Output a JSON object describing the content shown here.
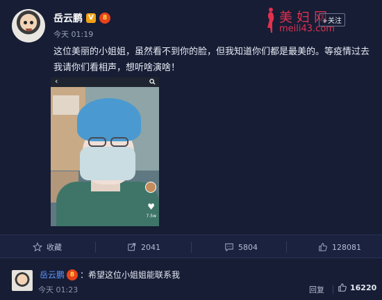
{
  "post": {
    "author": "岳云鹏",
    "verified_badge": "V",
    "rank_badge": "8",
    "time": "今天 01:19",
    "follow_label": "+关注",
    "text_line1": "这位美丽的小姐姐，虽然看不到你的脸，但我知道你们都是最美的。等疫情过去",
    "text_line2": "我请你们看相声，想听啥演啥！"
  },
  "watermark": {
    "title": "美妇网",
    "url": "meili43.com"
  },
  "media": {
    "back_icon": "‹",
    "like_count_label": "7.5w"
  },
  "actions": {
    "favorite_label": "收藏",
    "share_count": "2041",
    "comment_count": "5804",
    "like_count": "128081"
  },
  "comment": {
    "author": "岳云鹏",
    "rank_badge": "8",
    "text": "：希望这位小姐姐能联系我",
    "time": "今天 01:23",
    "reply_label": "回复",
    "like_count": "16220"
  },
  "colors": {
    "background": "#161d35",
    "link_blue": "#5f97ff",
    "watermark_red": "#e2304f"
  }
}
